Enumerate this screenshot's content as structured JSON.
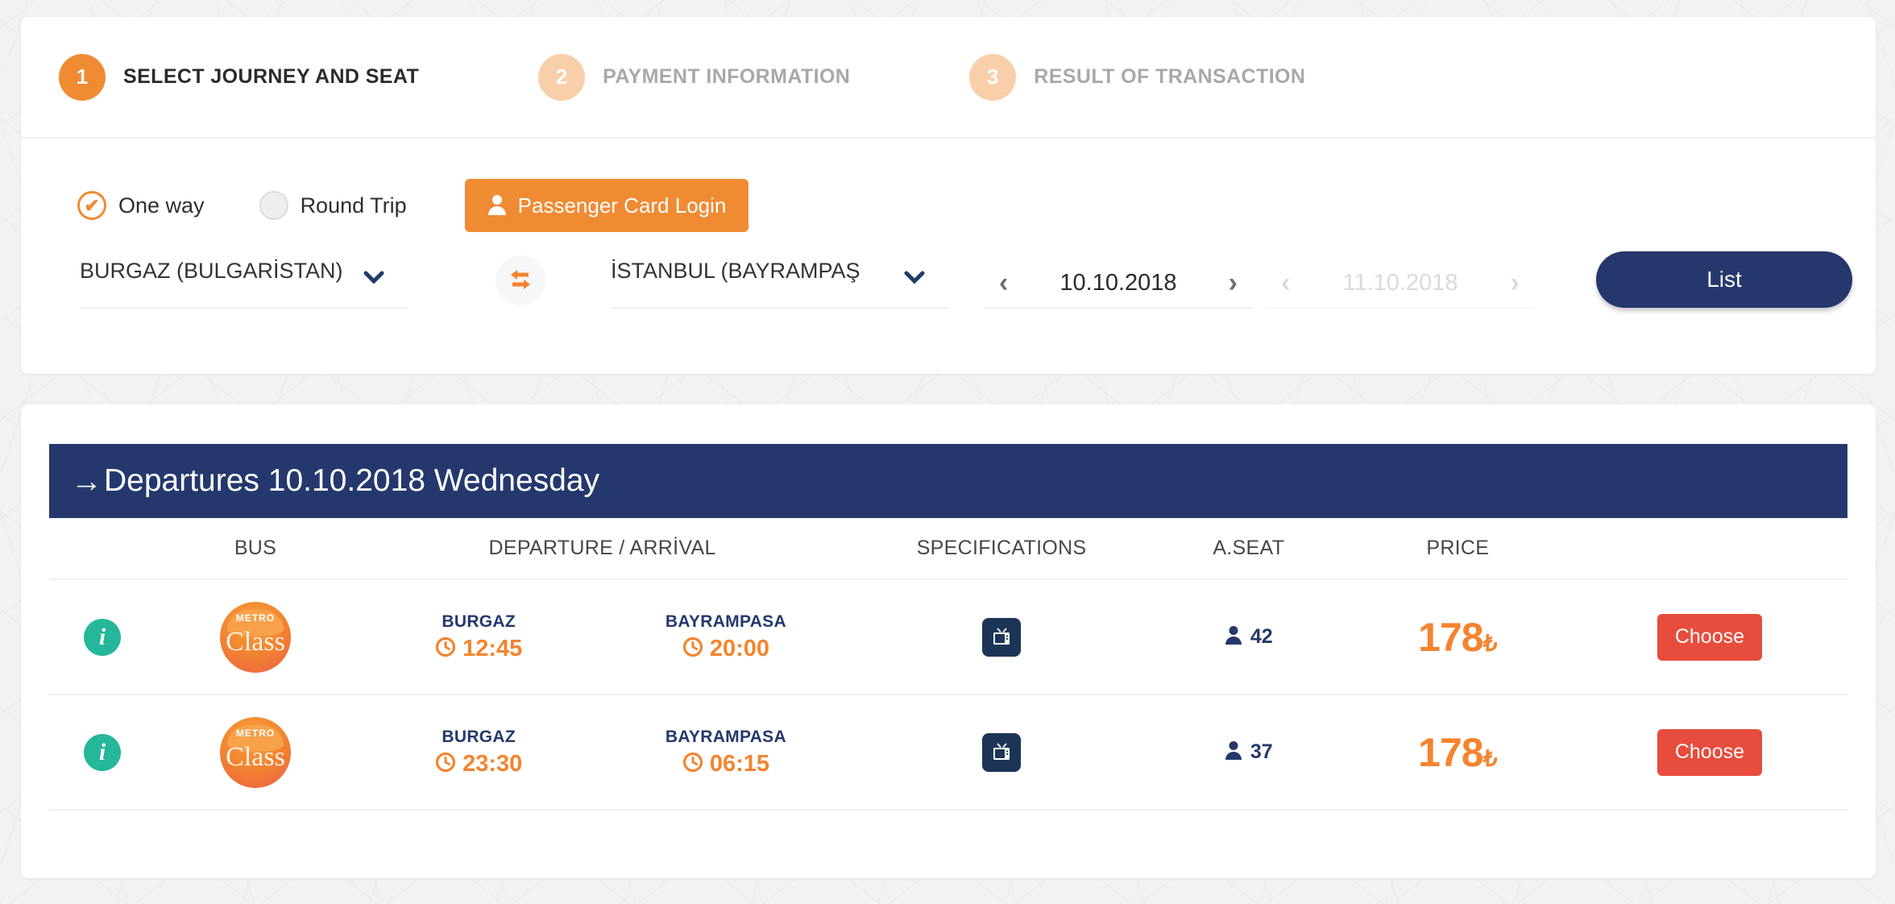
{
  "theme": {
    "orange": "#ef8b33",
    "navy": "#25386d",
    "teal": "#25b79a",
    "red": "#e74c3c",
    "muted": "#a8a8a8",
    "page_bg": "#f2f2f2"
  },
  "stepper": {
    "steps": [
      {
        "number": "1",
        "label": "SELECT JOURNEY AND SEAT",
        "state": "active"
      },
      {
        "number": "2",
        "label": "PAYMENT INFORMATION",
        "state": "inactive"
      },
      {
        "number": "3",
        "label": "RESULT OF TRANSACTION",
        "state": "inactive"
      }
    ]
  },
  "trip_type": {
    "one_way": {
      "label": "One way",
      "selected": true,
      "check_glyph": "✔"
    },
    "round_trip": {
      "label": "Round Trip",
      "selected": false
    },
    "passenger_login": {
      "label": "Passenger Card Login",
      "icon": "user-icon"
    }
  },
  "search": {
    "origin": {
      "value": "BURGAZ (BULGARİSTAN)",
      "chevron": "chevron-down-icon"
    },
    "destination": {
      "value": "İSTANBUL (BAYRAMPAŞ",
      "chevron": "chevron-down-icon"
    },
    "swap": {
      "icon": "swap-horizontal-icon"
    },
    "departure_date": {
      "value": "10.10.2018",
      "prev": "‹",
      "next": "›",
      "enabled": true
    },
    "return_date": {
      "value": "11.10.2018",
      "prev": "‹",
      "next": "›",
      "enabled": false
    },
    "list_button": {
      "label": "List"
    }
  },
  "results": {
    "header": {
      "arrow": "→",
      "title": "Departures 10.10.2018 Wednesday"
    },
    "columns": [
      {
        "key": "info",
        "label": ""
      },
      {
        "key": "bus",
        "label": "BUS"
      },
      {
        "key": "route",
        "label": "DEPARTURE / ARRİVAL"
      },
      {
        "key": "spec",
        "label": "SPECIFICATIONS"
      },
      {
        "key": "seat",
        "label": "A.SEAT"
      },
      {
        "key": "price",
        "label": "PRICE"
      },
      {
        "key": "action",
        "label": ""
      }
    ],
    "rows": [
      {
        "info_icon": "info-icon",
        "bus": {
          "brand_top": "METRO",
          "brand_bottom": "Class"
        },
        "departure": {
          "city": "BURGAZ",
          "time": "12:45",
          "clock": "🕐"
        },
        "arrival": {
          "city": "BAYRAMPASA",
          "time": "20:00",
          "clock": "🕐"
        },
        "specifications": [
          "tv-icon"
        ],
        "available_seats": "42",
        "price_amount": "178",
        "price_currency": "₺",
        "choose_label": "Choose"
      },
      {
        "info_icon": "info-icon",
        "bus": {
          "brand_top": "METRO",
          "brand_bottom": "Class"
        },
        "departure": {
          "city": "BURGAZ",
          "time": "23:30",
          "clock": "🕐"
        },
        "arrival": {
          "city": "BAYRAMPASA",
          "time": "06:15",
          "clock": "🕐"
        },
        "specifications": [
          "tv-icon"
        ],
        "available_seats": "37",
        "price_amount": "178",
        "price_currency": "₺",
        "choose_label": "Choose"
      }
    ]
  }
}
